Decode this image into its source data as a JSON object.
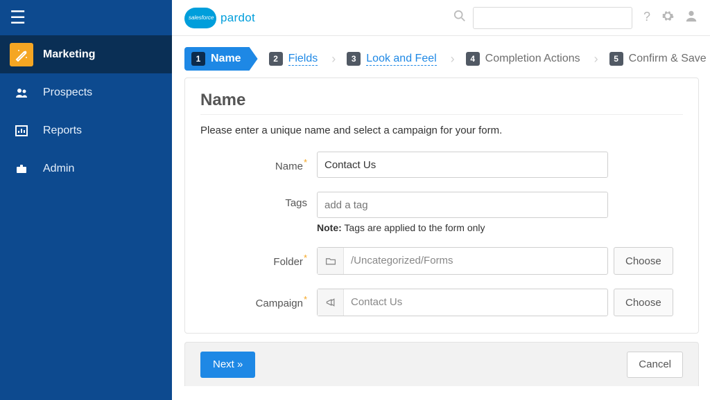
{
  "brand": {
    "cloud_text": "salesforce",
    "name": "pardot"
  },
  "topbar": {
    "search_placeholder": ""
  },
  "sidebar": {
    "items": [
      {
        "label": "Marketing"
      },
      {
        "label": "Prospects"
      },
      {
        "label": "Reports"
      },
      {
        "label": "Admin"
      }
    ]
  },
  "wizard": {
    "steps": [
      {
        "num": "1",
        "label": "Name"
      },
      {
        "num": "2",
        "label": "Fields"
      },
      {
        "num": "3",
        "label": "Look and Feel"
      },
      {
        "num": "4",
        "label": "Completion Actions"
      },
      {
        "num": "5",
        "label": "Confirm & Save"
      }
    ]
  },
  "panel": {
    "title": "Name",
    "subtitle": "Please enter a unique name and select a campaign for your form.",
    "name_label": "Name",
    "name_value": "Contact Us",
    "tags_label": "Tags",
    "tags_placeholder": "add a tag",
    "tags_note_prefix": "Note:",
    "tags_note_text": " Tags are applied to the form only",
    "folder_label": "Folder",
    "folder_value": "/Uncategorized/Forms",
    "campaign_label": "Campaign",
    "campaign_value": "Contact Us",
    "choose_label": "Choose"
  },
  "footer": {
    "next_label": "Next »",
    "cancel_label": "Cancel"
  }
}
